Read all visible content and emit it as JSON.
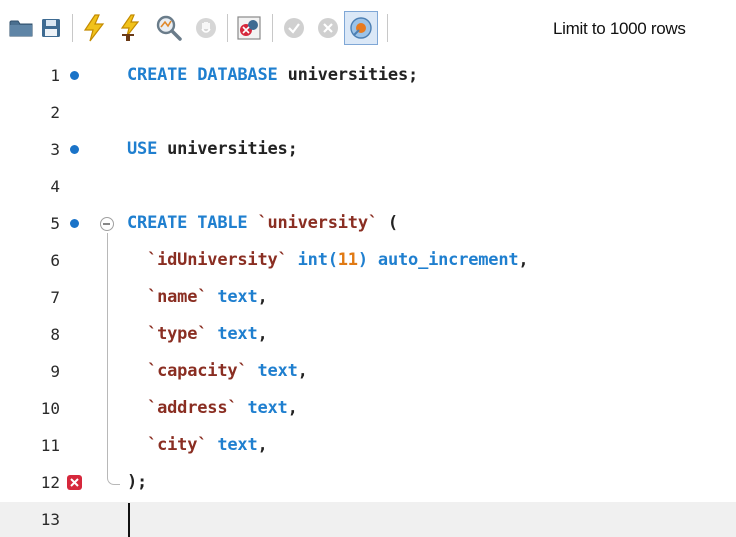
{
  "toolbar": {
    "limit_label": "Limit to 1000 rows",
    "icons": [
      "folder-icon",
      "save-icon",
      "execute-icon",
      "execute-current-icon",
      "explain-icon",
      "stop-icon",
      "toggle-error-icon",
      "commit-icon",
      "rollback-icon",
      "autocommit-icon"
    ]
  },
  "editor": {
    "line_numbers": [
      "1",
      "2",
      "3",
      "4",
      "5",
      "6",
      "7",
      "8",
      "9",
      "10",
      "11",
      "12",
      "13"
    ],
    "lines": {
      "l1": [
        "CREATE DATABASE",
        " universities;"
      ],
      "l3": [
        "USE",
        " universities;"
      ],
      "l5": [
        "CREATE TABLE",
        " ",
        "`university`",
        " ("
      ],
      "l6": [
        "  ",
        "`idUniversity`",
        " ",
        "int(",
        "11",
        ")",
        " auto_increment",
        ","
      ],
      "l7": [
        "  ",
        "`name`",
        " ",
        "text",
        ","
      ],
      "l8": [
        "  ",
        "`type`",
        " ",
        "text",
        ","
      ],
      "l9": [
        "  ",
        "`capacity`",
        " ",
        "text",
        ","
      ],
      "l10": [
        "  ",
        "`address`",
        " ",
        "text",
        ","
      ],
      "l11": [
        "  ",
        "`city`",
        " ",
        "text",
        ","
      ],
      "l12": [
        ");"
      ]
    },
    "colors": {
      "keyword": "#1f7fcf",
      "identifier": "#222222",
      "backtick_name": "#8a2e22",
      "number": "#e07a14",
      "statement_marker": "#1a73c8",
      "error_marker": "#d6283c"
    }
  }
}
